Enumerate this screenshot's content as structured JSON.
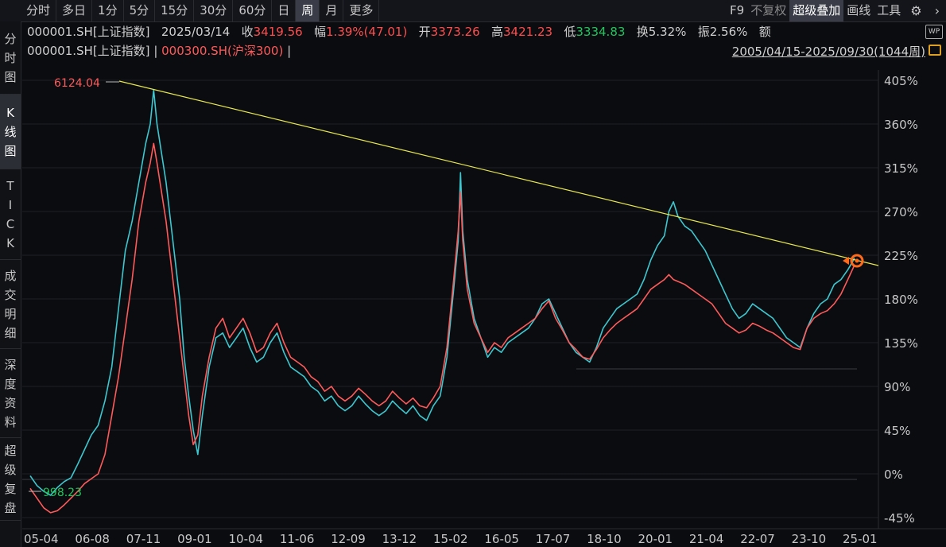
{
  "tabs": [
    {
      "label": "分时",
      "active": false
    },
    {
      "label": "多日",
      "active": false
    },
    {
      "label": "1分",
      "active": false
    },
    {
      "label": "5分",
      "active": false
    },
    {
      "label": "15分",
      "active": false
    },
    {
      "label": "30分",
      "active": false
    },
    {
      "label": "60分",
      "active": false
    },
    {
      "label": "日",
      "active": false
    },
    {
      "label": "周",
      "active": true
    },
    {
      "label": "月",
      "active": false
    },
    {
      "label": "更多",
      "active": false
    }
  ],
  "right_tools": {
    "f9": "F9",
    "no_restore": "不复权",
    "super_overlay": "超级叠加",
    "draw": "画线",
    "tools": "工具",
    "settings_icon": "gear-icon",
    "collapse_icon": "chevron-right-icon"
  },
  "left_nav": [
    {
      "label": "分时图",
      "active": false
    },
    {
      "label": "K线图",
      "active": true
    },
    {
      "label": "TICK",
      "active": false
    },
    {
      "label": "成交明细",
      "active": false
    },
    {
      "label": "深度资料",
      "active": false
    },
    {
      "label": "超级复盘",
      "active": false
    }
  ],
  "quote": {
    "symbol": "000001.SH[上证指数]",
    "date": "2025/03/14",
    "close_label": "收",
    "close": "3419.56",
    "change_label": "幅",
    "change": "1.39%(47.01)",
    "open_label": "开",
    "open": "3373.26",
    "high_label": "高",
    "high": "3421.23",
    "low_label": "低",
    "low": "3334.83",
    "turnover_label": "换",
    "turnover": "5.32%",
    "amplitude_label": "振",
    "amplitude": "2.56%",
    "amount_label": "额",
    "wp_badge": "WP"
  },
  "overlay": {
    "main": "000001.SH[上证指数]",
    "sep1": " | ",
    "compare": "000300.SH(沪深300)",
    "sep2": " |",
    "range": "2005/04/15-2025/09/30(1044周)"
  },
  "colors": {
    "main_series": "#ff5a5a",
    "compare_series": "#3cc8d0",
    "trendline": "#e8e84a",
    "marker": "#ff6a1a"
  },
  "chart_data": {
    "type": "line",
    "y_ticks": [
      "405%",
      "360%",
      "315%",
      "270%",
      "225%",
      "180%",
      "135%",
      "90%",
      "45%",
      "0%",
      "-45%"
    ],
    "ylim": [
      -45,
      405
    ],
    "x_ticks": [
      "05-04",
      "06-08",
      "07-11",
      "09-01",
      "10-04",
      "11-06",
      "12-09",
      "13-12",
      "15-02",
      "16-05",
      "17-07",
      "18-10",
      "20-01",
      "21-04",
      "22-07",
      "23-10",
      "25-01"
    ],
    "annotations": {
      "max_label": "6124.04",
      "min_label": "998.23"
    },
    "series": [
      {
        "values": [
          [
            0,
            -2
          ],
          [
            0.3,
            -12
          ],
          [
            0.6,
            -18
          ],
          [
            0.9,
            -22
          ],
          [
            1.2,
            -14
          ],
          [
            1.5,
            -8
          ],
          [
            1.8,
            -4
          ],
          [
            2.1,
            10
          ],
          [
            2.4,
            25
          ],
          [
            2.7,
            40
          ],
          [
            3.0,
            50
          ],
          [
            3.3,
            75
          ],
          [
            3.6,
            110
          ],
          [
            3.9,
            170
          ],
          [
            4.2,
            230
          ],
          [
            4.5,
            260
          ],
          [
            4.8,
            300
          ],
          [
            5.1,
            340
          ],
          [
            5.3,
            360
          ],
          [
            5.45,
            395
          ],
          [
            5.6,
            360
          ],
          [
            5.8,
            330
          ],
          [
            6.0,
            300
          ],
          [
            6.2,
            260
          ],
          [
            6.4,
            220
          ],
          [
            6.6,
            180
          ],
          [
            6.8,
            120
          ],
          [
            7.0,
            80
          ],
          [
            7.2,
            45
          ],
          [
            7.4,
            20
          ],
          [
            7.6,
            60
          ],
          [
            7.9,
            110
          ],
          [
            8.2,
            140
          ],
          [
            8.5,
            145
          ],
          [
            8.8,
            130
          ],
          [
            9.1,
            140
          ],
          [
            9.4,
            150
          ],
          [
            9.7,
            130
          ],
          [
            10.0,
            115
          ],
          [
            10.3,
            120
          ],
          [
            10.6,
            135
          ],
          [
            10.9,
            145
          ],
          [
            11.2,
            125
          ],
          [
            11.5,
            110
          ],
          [
            11.8,
            105
          ],
          [
            12.1,
            100
          ],
          [
            12.4,
            90
          ],
          [
            12.7,
            85
          ],
          [
            13.0,
            75
          ],
          [
            13.3,
            80
          ],
          [
            13.6,
            70
          ],
          [
            13.9,
            65
          ],
          [
            14.2,
            70
          ],
          [
            14.5,
            80
          ],
          [
            14.8,
            72
          ],
          [
            15.1,
            65
          ],
          [
            15.4,
            60
          ],
          [
            15.7,
            65
          ],
          [
            16.0,
            75
          ],
          [
            16.3,
            68
          ],
          [
            16.6,
            62
          ],
          [
            16.9,
            70
          ],
          [
            17.2,
            60
          ],
          [
            17.5,
            55
          ],
          [
            17.8,
            70
          ],
          [
            18.1,
            80
          ],
          [
            18.4,
            120
          ],
          [
            18.7,
            190
          ],
          [
            18.9,
            240
          ],
          [
            19.0,
            310
          ],
          [
            19.1,
            250
          ],
          [
            19.3,
            200
          ],
          [
            19.6,
            160
          ],
          [
            19.9,
            140
          ],
          [
            20.2,
            120
          ],
          [
            20.5,
            130
          ],
          [
            20.8,
            125
          ],
          [
            21.1,
            135
          ],
          [
            21.4,
            140
          ],
          [
            21.7,
            145
          ],
          [
            22.0,
            150
          ],
          [
            22.3,
            160
          ],
          [
            22.6,
            175
          ],
          [
            22.9,
            180
          ],
          [
            23.2,
            165
          ],
          [
            23.5,
            150
          ],
          [
            23.8,
            135
          ],
          [
            24.1,
            125
          ],
          [
            24.4,
            120
          ],
          [
            24.7,
            115
          ],
          [
            25.0,
            130
          ],
          [
            25.3,
            150
          ],
          [
            25.6,
            160
          ],
          [
            25.9,
            170
          ],
          [
            26.2,
            175
          ],
          [
            26.5,
            180
          ],
          [
            26.8,
            185
          ],
          [
            27.1,
            200
          ],
          [
            27.4,
            220
          ],
          [
            27.7,
            235
          ],
          [
            28.0,
            245
          ],
          [
            28.2,
            270
          ],
          [
            28.4,
            280
          ],
          [
            28.6,
            265
          ],
          [
            28.9,
            255
          ],
          [
            29.2,
            250
          ],
          [
            29.5,
            240
          ],
          [
            29.8,
            230
          ],
          [
            30.1,
            215
          ],
          [
            30.4,
            200
          ],
          [
            30.7,
            185
          ],
          [
            31.0,
            170
          ],
          [
            31.3,
            160
          ],
          [
            31.6,
            165
          ],
          [
            31.9,
            175
          ],
          [
            32.2,
            170
          ],
          [
            32.5,
            165
          ],
          [
            32.8,
            160
          ],
          [
            33.1,
            150
          ],
          [
            33.4,
            140
          ],
          [
            33.7,
            135
          ],
          [
            34.0,
            130
          ],
          [
            34.3,
            150
          ],
          [
            34.6,
            165
          ],
          [
            34.9,
            175
          ],
          [
            35.2,
            180
          ],
          [
            35.5,
            195
          ],
          [
            35.8,
            200
          ],
          [
            36.1,
            210
          ],
          [
            36.4,
            222
          ]
        ]
      },
      {
        "values": [
          [
            0,
            -15
          ],
          [
            0.3,
            -25
          ],
          [
            0.6,
            -35
          ],
          [
            0.9,
            -40
          ],
          [
            1.2,
            -38
          ],
          [
            1.5,
            -32
          ],
          [
            1.8,
            -25
          ],
          [
            2.1,
            -18
          ],
          [
            2.4,
            -10
          ],
          [
            2.7,
            -5
          ],
          [
            3.0,
            0
          ],
          [
            3.3,
            20
          ],
          [
            3.6,
            60
          ],
          [
            3.9,
            100
          ],
          [
            4.2,
            150
          ],
          [
            4.5,
            200
          ],
          [
            4.8,
            260
          ],
          [
            5.1,
            300
          ],
          [
            5.3,
            320
          ],
          [
            5.45,
            340
          ],
          [
            5.6,
            320
          ],
          [
            5.8,
            290
          ],
          [
            6.0,
            260
          ],
          [
            6.2,
            220
          ],
          [
            6.4,
            180
          ],
          [
            6.6,
            140
          ],
          [
            6.8,
            100
          ],
          [
            7.0,
            60
          ],
          [
            7.2,
            30
          ],
          [
            7.4,
            40
          ],
          [
            7.6,
            80
          ],
          [
            7.9,
            120
          ],
          [
            8.2,
            150
          ],
          [
            8.5,
            160
          ],
          [
            8.8,
            140
          ],
          [
            9.1,
            150
          ],
          [
            9.4,
            160
          ],
          [
            9.7,
            145
          ],
          [
            10.0,
            125
          ],
          [
            10.3,
            130
          ],
          [
            10.6,
            145
          ],
          [
            10.9,
            155
          ],
          [
            11.2,
            135
          ],
          [
            11.5,
            120
          ],
          [
            11.8,
            115
          ],
          [
            12.1,
            110
          ],
          [
            12.4,
            100
          ],
          [
            12.7,
            95
          ],
          [
            13.0,
            85
          ],
          [
            13.3,
            90
          ],
          [
            13.6,
            80
          ],
          [
            13.9,
            75
          ],
          [
            14.2,
            80
          ],
          [
            14.5,
            88
          ],
          [
            14.8,
            82
          ],
          [
            15.1,
            75
          ],
          [
            15.4,
            70
          ],
          [
            15.7,
            75
          ],
          [
            16.0,
            85
          ],
          [
            16.3,
            78
          ],
          [
            16.6,
            72
          ],
          [
            16.9,
            78
          ],
          [
            17.2,
            70
          ],
          [
            17.5,
            68
          ],
          [
            17.8,
            78
          ],
          [
            18.1,
            90
          ],
          [
            18.4,
            130
          ],
          [
            18.7,
            200
          ],
          [
            18.9,
            250
          ],
          [
            19.0,
            290
          ],
          [
            19.1,
            240
          ],
          [
            19.3,
            190
          ],
          [
            19.6,
            155
          ],
          [
            19.9,
            140
          ],
          [
            20.2,
            125
          ],
          [
            20.5,
            135
          ],
          [
            20.8,
            130
          ],
          [
            21.1,
            140
          ],
          [
            21.4,
            145
          ],
          [
            21.7,
            150
          ],
          [
            22.0,
            155
          ],
          [
            22.3,
            160
          ],
          [
            22.6,
            170
          ],
          [
            22.9,
            178
          ],
          [
            23.2,
            160
          ],
          [
            23.5,
            148
          ],
          [
            23.8,
            135
          ],
          [
            24.1,
            128
          ],
          [
            24.4,
            120
          ],
          [
            24.7,
            118
          ],
          [
            25.0,
            128
          ],
          [
            25.3,
            140
          ],
          [
            25.6,
            148
          ],
          [
            25.9,
            155
          ],
          [
            26.2,
            160
          ],
          [
            26.5,
            165
          ],
          [
            26.8,
            170
          ],
          [
            27.1,
            180
          ],
          [
            27.4,
            190
          ],
          [
            27.7,
            195
          ],
          [
            28.0,
            200
          ],
          [
            28.2,
            205
          ],
          [
            28.4,
            200
          ],
          [
            28.6,
            198
          ],
          [
            28.9,
            195
          ],
          [
            29.2,
            190
          ],
          [
            29.5,
            185
          ],
          [
            29.8,
            180
          ],
          [
            30.1,
            175
          ],
          [
            30.4,
            165
          ],
          [
            30.7,
            155
          ],
          [
            31.0,
            150
          ],
          [
            31.3,
            145
          ],
          [
            31.6,
            148
          ],
          [
            31.9,
            155
          ],
          [
            32.2,
            152
          ],
          [
            32.5,
            148
          ],
          [
            32.8,
            145
          ],
          [
            33.1,
            140
          ],
          [
            33.4,
            135
          ],
          [
            33.7,
            130
          ],
          [
            34.0,
            128
          ],
          [
            34.3,
            150
          ],
          [
            34.6,
            160
          ],
          [
            34.9,
            165
          ],
          [
            35.2,
            168
          ],
          [
            35.5,
            175
          ],
          [
            35.8,
            185
          ],
          [
            36.1,
            200
          ],
          [
            36.4,
            215
          ]
        ]
      }
    ]
  }
}
